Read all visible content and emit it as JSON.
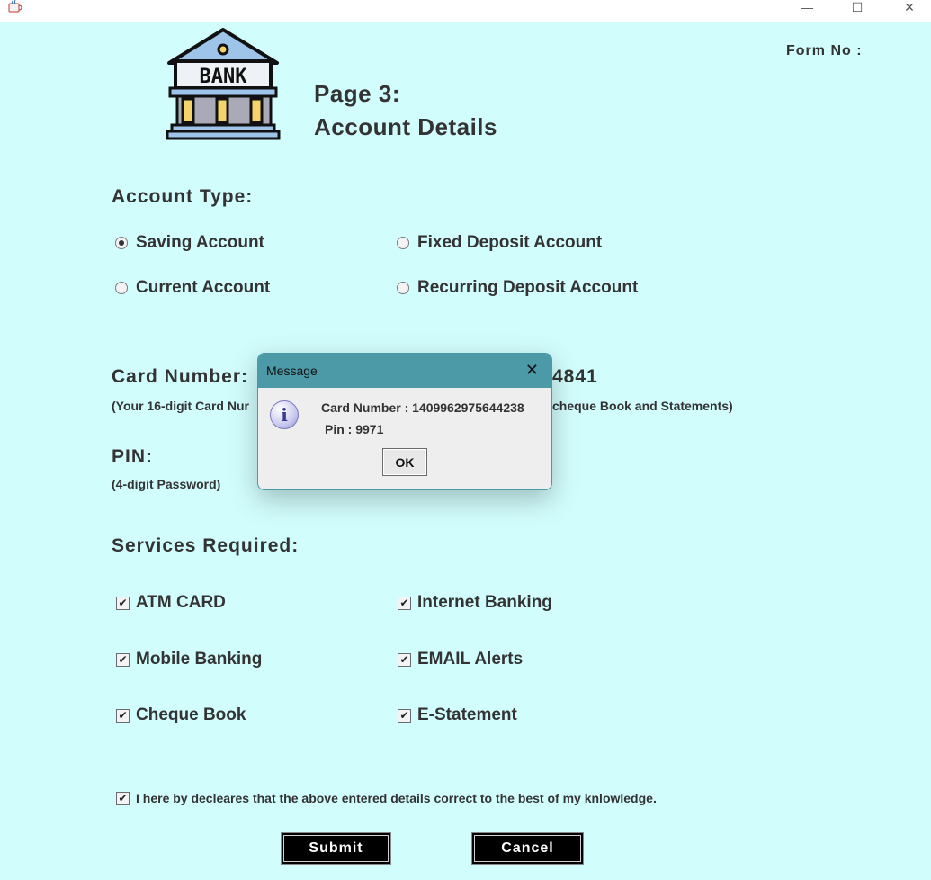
{
  "window": {
    "minimize_glyph": "—",
    "maximize_glyph": "☐",
    "close_glyph": "✕"
  },
  "header": {
    "form_no": "Form No :",
    "title_line1": "Page 3:",
    "title_line2": "Account Details",
    "logo_text": "BANK"
  },
  "account_type": {
    "heading": "Account Type:",
    "options": [
      {
        "label": "Saving Account",
        "checked": true
      },
      {
        "label": "Fixed Deposit Account",
        "checked": false
      },
      {
        "label": "Current Account",
        "checked": false
      },
      {
        "label": "Recurring Deposit Account",
        "checked": false
      }
    ]
  },
  "card": {
    "label": "Card Number:",
    "value_partial": "4841",
    "note_left": "(Your 16-digit Card Nur",
    "note_right": "cheque Book and Statements)"
  },
  "pin": {
    "label": "PIN:",
    "note": "(4-digit Password)"
  },
  "services": {
    "heading": "Services Required:",
    "items": [
      {
        "label": "ATM CARD",
        "checked": true
      },
      {
        "label": "Internet Banking",
        "checked": true
      },
      {
        "label": "Mobile Banking",
        "checked": true
      },
      {
        "label": "EMAIL Alerts",
        "checked": true
      },
      {
        "label": "Cheque Book",
        "checked": true
      },
      {
        "label": "E-Statement",
        "checked": true
      }
    ]
  },
  "declaration": {
    "label": "I here by decleares that the above entered details correct to the best of my knlowledge.",
    "checked": true
  },
  "buttons": {
    "submit": "Submit",
    "cancel": "Cancel"
  },
  "dialog": {
    "title": "Message",
    "close_glyph": "✕",
    "icon": "info-icon",
    "icon_glyph": "i",
    "line1": "Card Number : 1409962975644238",
    "line2": "Pin : 9971",
    "ok": "OK"
  },
  "check_glyph": "✔"
}
